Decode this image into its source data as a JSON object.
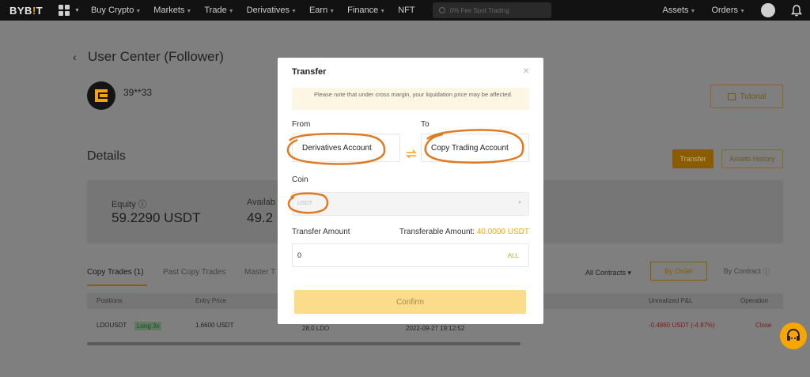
{
  "nav": {
    "logo_main": "BYB",
    "logo_accent": "!",
    "logo_end": "T",
    "items": [
      "Buy Crypto",
      "Markets",
      "Trade",
      "Derivatives",
      "Earn",
      "Finance",
      "NFT"
    ],
    "search_placeholder": "0% Fee Spot Trading",
    "right_items": [
      "Assets",
      "Orders"
    ]
  },
  "page": {
    "back_icon": "‹",
    "title": "User Center (Follower)",
    "username": "39**33",
    "tutorial_label": "Tutorial",
    "details_heading": "Details",
    "transfer_label": "Transfer",
    "assets_history_label": "Assets History",
    "equity_label": "Equity ⓘ",
    "equity_value": "59.2290 USDT",
    "available_label": "Availab",
    "available_value": "49.2",
    "tabs": [
      "Copy Trades (1)",
      "Past Copy Trades",
      "Master T"
    ],
    "all_contracts_label": "All Contracts",
    "by_order_label": "By Order",
    "by_contract_label": "By Contract",
    "table_headers": [
      "Positions",
      "Entry Price",
      "Unrealized P&L",
      "Operation"
    ],
    "row": {
      "symbol": "LDOUSDT",
      "side": "Long 3x",
      "entry_price": "1.6600 USDT",
      "qty": "28.0 LDO",
      "time": "2022-09-27 19:12:52",
      "unrealized": "-0.4860 USDT (-4.87%)",
      "operation": "Close"
    }
  },
  "modal": {
    "title": "Transfer",
    "close_icon": "×",
    "notice": "Please note that under cross margin, your liquidation price may be affected.",
    "from_label": "From",
    "to_label": "To",
    "from_value": "Derivatives Account",
    "to_value": "Copy Trading Account",
    "swap_icon": "⇄",
    "coin_label": "Coin",
    "coin_value": "USDT",
    "amount_label": "Transfer Amount",
    "transferable_label": "Transferable Amount:",
    "transferable_value": "40.0000 USDT",
    "amount_value": "0",
    "all_label": "ALL",
    "confirm_label": "Confirm"
  },
  "colors": {
    "accent": "#f7a600",
    "annotation": "#e07a20"
  }
}
